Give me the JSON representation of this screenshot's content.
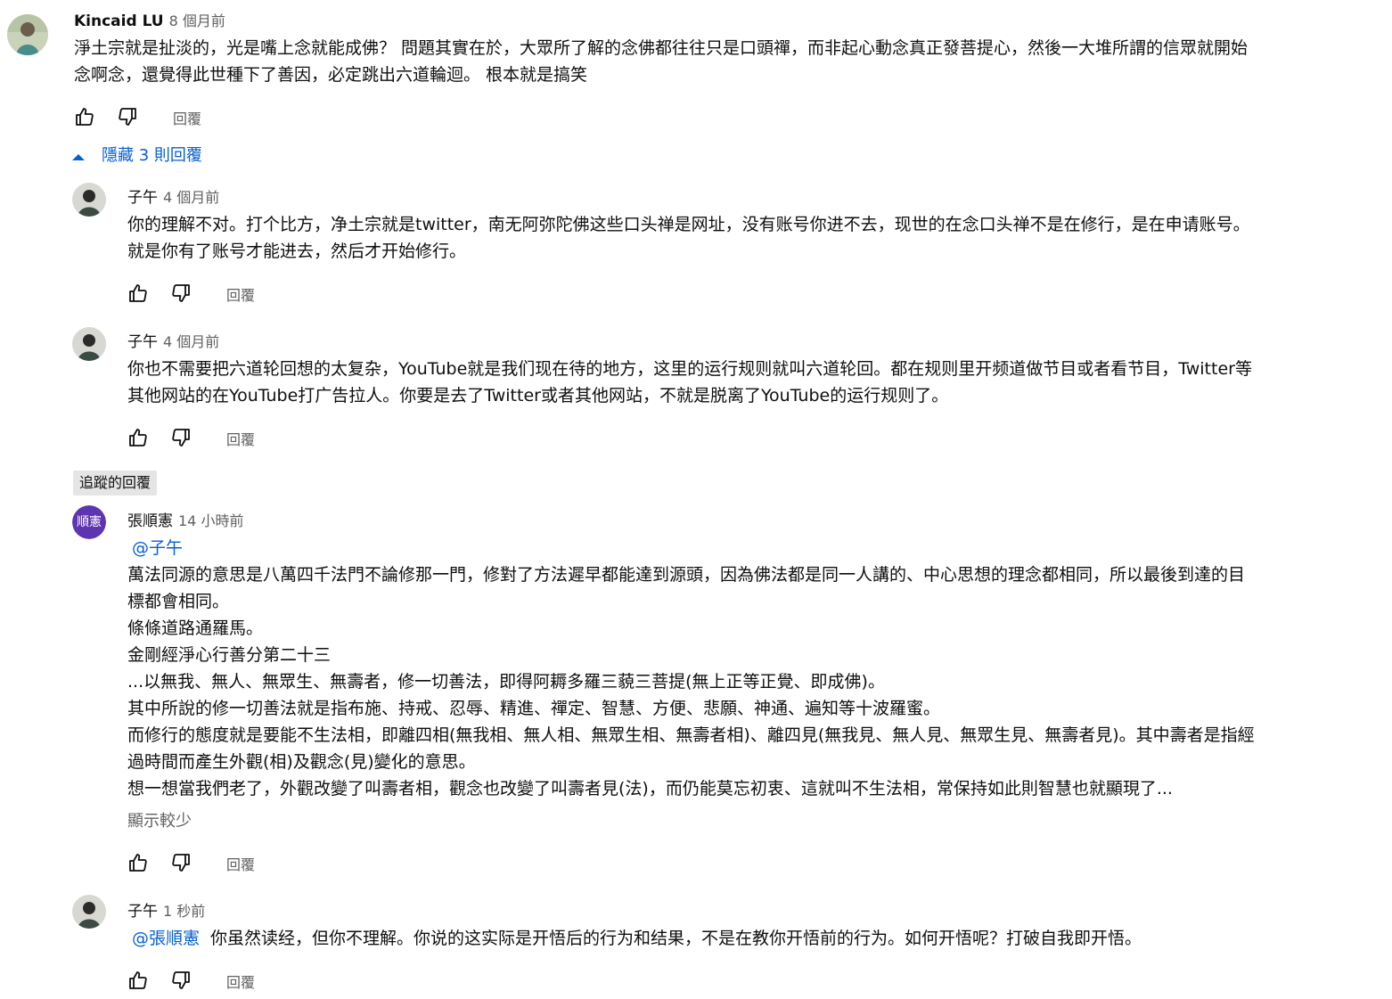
{
  "top_comment": {
    "author": "Kincaid LU",
    "time": "8 個月前",
    "lines": [
      "淨土宗就是扯淡的，光是嘴上念就能成佛？ 問題其實在於，大眾所了解的念佛都往往只是口頭禪，而非起心動念真正發菩提心，然後一大堆所謂的信眾就開始",
      "念啊念，還覺得此世種下了善因，必定跳出六道輪迴。 根本就是搞笑"
    ],
    "reply_label": "回覆"
  },
  "replies_toggle": {
    "label": "隱藏 3 則回覆"
  },
  "reply1": {
    "author": "子午",
    "time": "4 個月前",
    "lines": [
      "你的理解不对。打个比方，净土宗就是twitter，南无阿弥陀佛这些口头禅是网址，没有账号你进不去，现世的在念口头禅不是在修行，是在申请账号。",
      "就是你有了账号才能进去，然后才开始修行。"
    ],
    "reply_label": "回覆"
  },
  "reply2": {
    "author": "子午",
    "time": "4 個月前",
    "lines": [
      "你也不需要把六道轮回想的太复杂，YouTube就是我们现在待的地方，这里的运行规则就叫六道轮回。都在规则里开频道做节目或者看节目，Twitter等",
      "其他网站的在YouTube打广告拉人。你要是去了Twitter或者其他网站，不就是脱离了YouTube的运行规则了。"
    ],
    "reply_label": "回覆"
  },
  "tracked_label": "追蹤的回覆",
  "reply3": {
    "avatar_text": "順憲",
    "avatar_color": "#5e35b1",
    "author": "張順憲",
    "time": "14 小時前",
    "mention": "@子午",
    "lines": [
      "萬法同源的意思是八萬四千法門不論修那一門，修對了方法遲早都能達到源頭，因為佛法都是同一人講的、中心思想的理念都相同，所以最後到達的目",
      "標都會相同。",
      "條條道路通羅馬。",
      "金剛經淨心行善分第二十三",
      "...以無我、無人、無眾生、無壽者，修一切善法，即得阿耨多羅三藐三菩提(無上正等正覺、即成佛)。",
      "其中所說的修一切善法就是指布施、持戒、忍辱、精進、禪定、智慧、方便、悲願、神通、遍知等十波羅蜜。",
      "而修行的態度就是要能不生法相，即離四相(無我相、無人相、無眾生相、無壽者相)、離四見(無我見、無人見、無眾生見、無壽者見)。其中壽者是指經",
      "過時間而產生外觀(相)及觀念(見)變化的意思。",
      "想一想當我們老了，外觀改變了叫壽者相，觀念也改變了叫壽者見(法)，而仍能莫忘初衷、這就叫不生法相，常保持如此則智慧也就顯現了..."
    ],
    "show_less": "顯示較少",
    "reply_label": "回覆"
  },
  "reply4": {
    "author": "子午",
    "time": "1 秒前",
    "mention": "@張順憲",
    "text": "你虽然读经，但你不理解。你说的这实际是开悟后的行为和结果，不是在教你开悟前的行为。如何开悟呢？打破自我即开悟。",
    "reply_label": "回覆"
  },
  "colors": {
    "link": "#065fd4",
    "secondary": "#606060",
    "chip_bg": "#e5e5e5"
  }
}
